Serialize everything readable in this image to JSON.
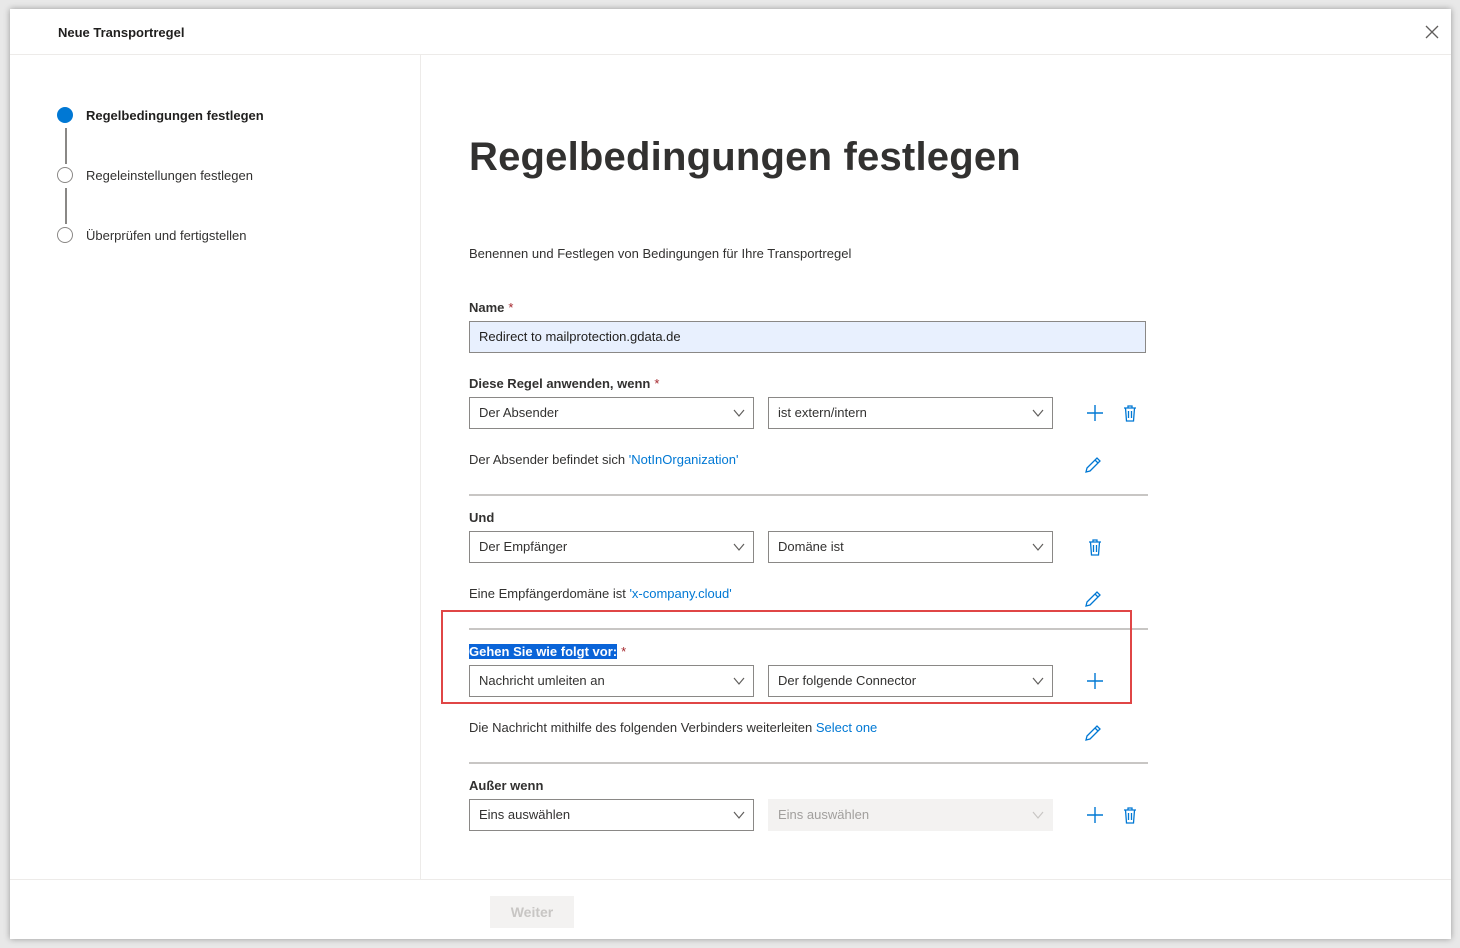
{
  "header": {
    "title": "Neue Transportregel",
    "close_icon": "close-icon"
  },
  "steps": [
    {
      "label": "Regelbedingungen festlegen",
      "state": "active"
    },
    {
      "label": "Regeleinstellungen festlegen",
      "state": "pending"
    },
    {
      "label": "Überprüfen und fertigstellen",
      "state": "pending"
    }
  ],
  "main": {
    "title": "Regelbedingungen festlegen",
    "description": "Benennen und Festlegen von Bedingungen für Ihre Transportregel",
    "name": {
      "label": "Name",
      "required_mark": "*",
      "value": "Redirect to mailprotection.gdata.de"
    },
    "apply_if": {
      "label": "Diese Regel anwenden, wenn",
      "required_mark": "*",
      "dropdown1": "Der Absender",
      "dropdown2": "ist extern/intern",
      "summary_text": "Der Absender befindet sich ",
      "summary_link": "'NotInOrganization'"
    },
    "and": {
      "label": "Und",
      "dropdown1": "Der Empfänger",
      "dropdown2": "Domäne ist",
      "summary_text": "Eine Empfängerdomäne ist ",
      "summary_link": "'x-company.cloud'"
    },
    "do": {
      "label": "Gehen Sie wie folgt vor:",
      "required_mark": "*",
      "dropdown1": "Nachricht umleiten an",
      "dropdown2": "Der folgende Connector",
      "summary_text": "Die Nachricht mithilfe des folgenden Verbinders weiterleiten ",
      "summary_link": "Select one"
    },
    "except": {
      "label": "Außer wenn",
      "dropdown1": "Eins auswählen",
      "dropdown2": "Eins auswählen"
    }
  },
  "footer": {
    "next_label": "Weiter"
  },
  "colors": {
    "accent": "#0078d4",
    "highlight_box": "#e04646"
  }
}
